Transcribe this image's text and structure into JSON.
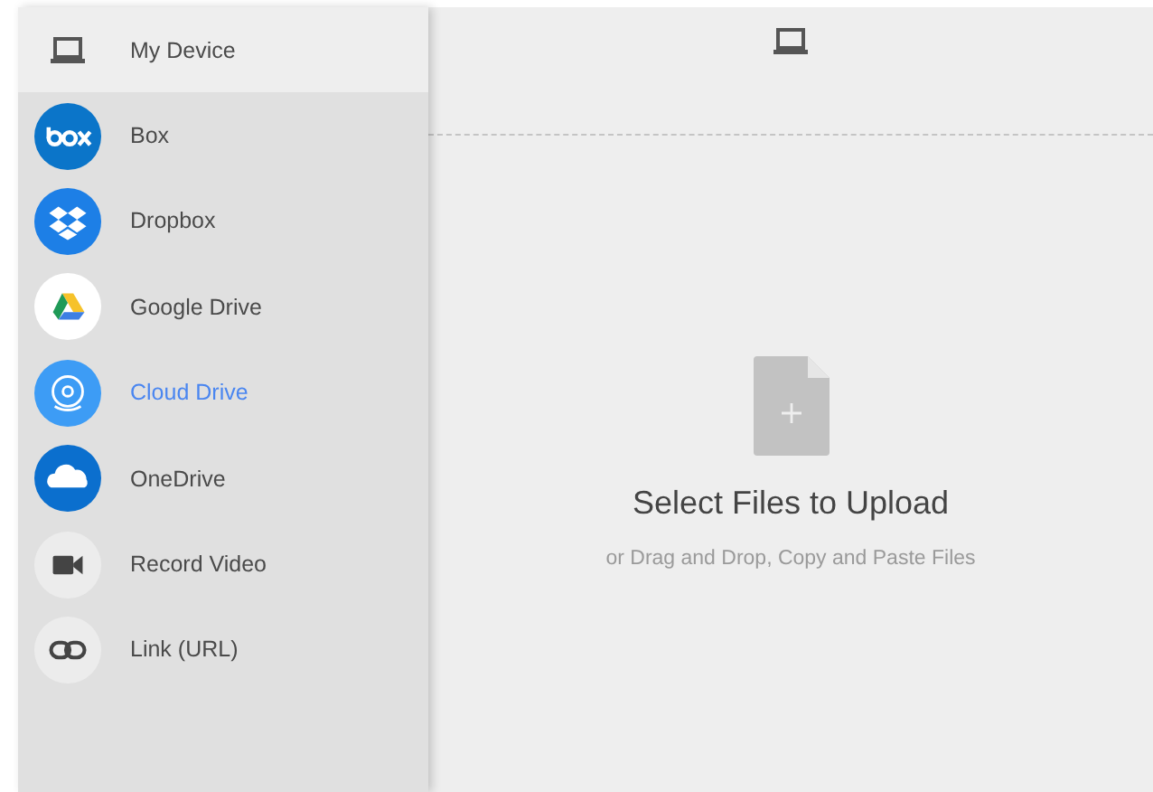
{
  "sidebar": {
    "items": [
      {
        "label": "My Device",
        "kind": "laptop",
        "selected": true,
        "highlighted": false
      },
      {
        "label": "Box",
        "kind": "box",
        "selected": false,
        "highlighted": false
      },
      {
        "label": "Dropbox",
        "kind": "dropbox",
        "selected": false,
        "highlighted": false
      },
      {
        "label": "Google Drive",
        "kind": "drive",
        "selected": false,
        "highlighted": false
      },
      {
        "label": "Cloud Drive",
        "kind": "amazon",
        "selected": false,
        "highlighted": true
      },
      {
        "label": "OneDrive",
        "kind": "onedrive",
        "selected": false,
        "highlighted": false
      },
      {
        "label": "Record Video",
        "kind": "video",
        "selected": false,
        "highlighted": false
      },
      {
        "label": "Link (URL)",
        "kind": "link",
        "selected": false,
        "highlighted": false
      }
    ]
  },
  "drop_zone": {
    "title": "Select Files to Upload",
    "hint": "or Drag and Drop, Copy and Paste Files"
  }
}
